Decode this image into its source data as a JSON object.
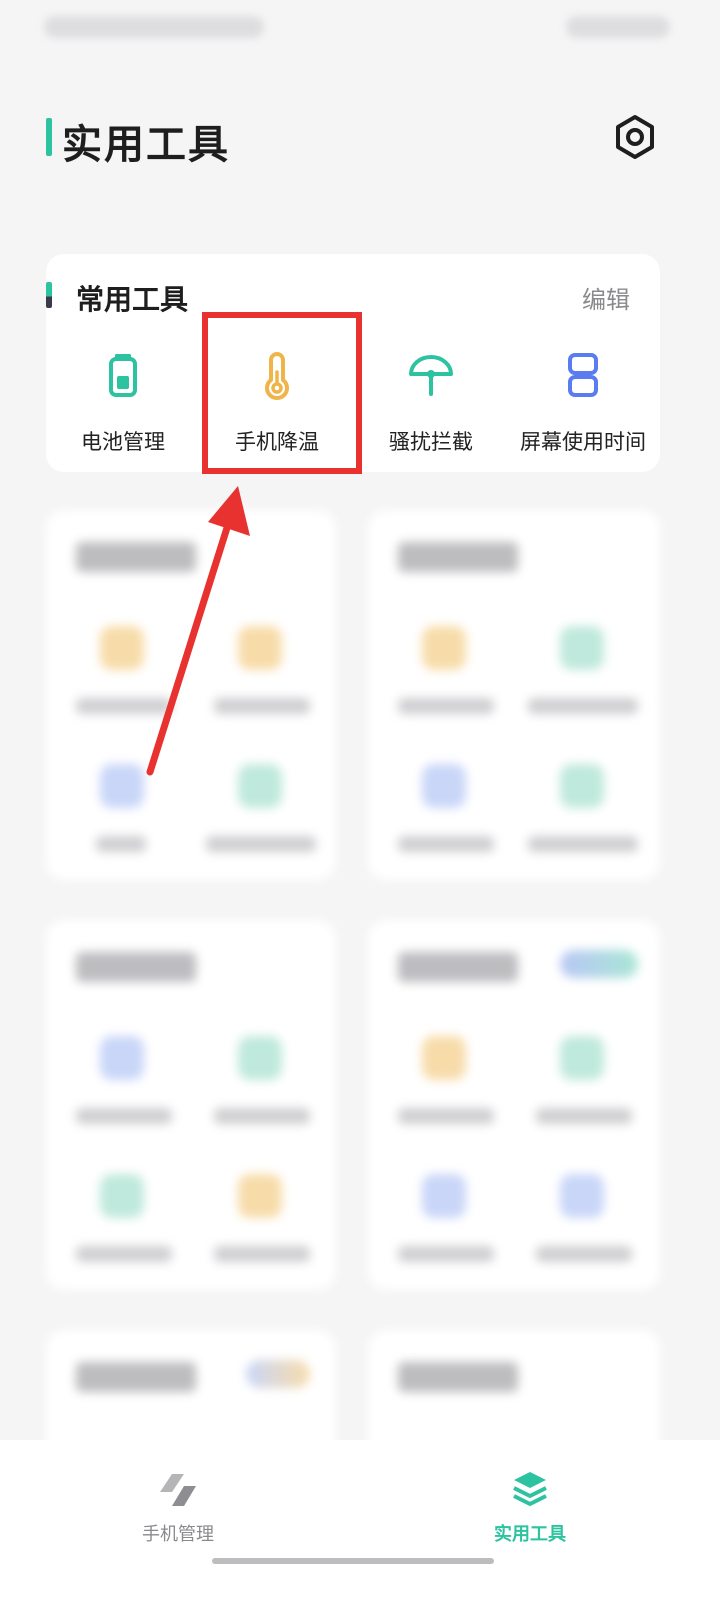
{
  "page": {
    "title": "实用工具"
  },
  "frequent_tools": {
    "title": "常用工具",
    "edit_label": "编辑",
    "items": [
      {
        "label": "电池管理",
        "icon": "battery-icon",
        "color": "#2ec3a0"
      },
      {
        "label": "手机降温",
        "icon": "thermometer-icon",
        "color": "#f0b54a"
      },
      {
        "label": "骚扰拦截",
        "icon": "umbrella-icon",
        "color": "#2ec3a0"
      },
      {
        "label": "屏幕使用时间",
        "icon": "hourglass-icon",
        "color": "#5b7cf0"
      }
    ]
  },
  "bottom_nav": {
    "items": [
      {
        "label": "手机管理",
        "icon": "phone-manager-icon",
        "active": false
      },
      {
        "label": "实用工具",
        "icon": "tools-layers-icon",
        "active": true
      }
    ]
  },
  "colors": {
    "accent": "#2ec3a0",
    "highlight": "#e8322f",
    "background": "#f5f5f6"
  }
}
